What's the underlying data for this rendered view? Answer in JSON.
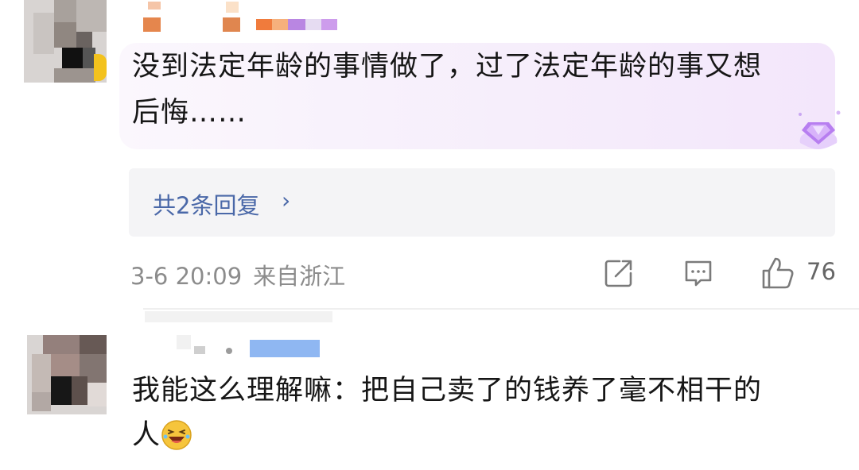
{
  "comments": [
    {
      "text_line1": "没到法定年龄的事情做了，过了法定年龄的事又想",
      "text_line2": "后悔……",
      "replies_label": "共2条回复",
      "replies_chevron": "›",
      "date": "3-6 20:09",
      "location": "来自浙江",
      "like_count": "76",
      "has_vip_gem": true
    },
    {
      "text_line1": "我能这么理解嘛：把自己卖了的钱养了毫不相干的",
      "text_line2": "人",
      "emoji": "laughing-emoji"
    }
  ],
  "colors": {
    "link": "#4a68a8",
    "meta": "#8c8c8c",
    "bubble": "#f6eefb",
    "reply_box": "#f4f4f6"
  },
  "icons": [
    "share-icon",
    "comment-icon",
    "thumbs-up-icon",
    "vip-gem-icon"
  ]
}
